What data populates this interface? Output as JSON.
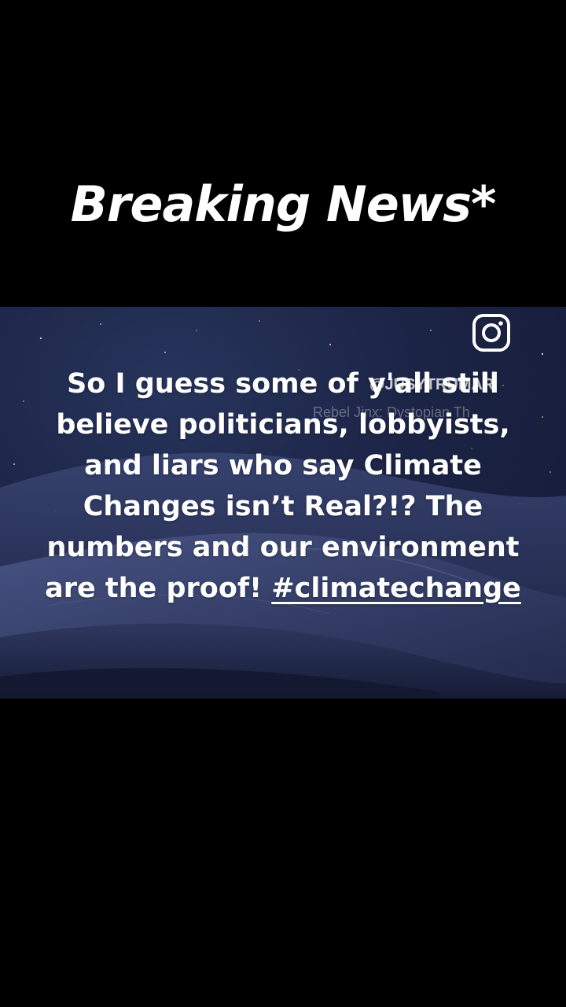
{
  "post": {
    "headline": "Breaking News*",
    "image": {
      "platform_icon": "instagram-icon",
      "watermark_handle": "@JUSYTRUMAR",
      "watermark_sub": "Rebel Jinx: Dystopian Th",
      "body_text": "So I guess some of y'all still believe politicians, lobbyists, and liars who say Climate Changes isn’t Real?!? The numbers and our environment are the proof! ",
      "hashtag": "#climatechange"
    }
  },
  "colors": {
    "background": "#000000",
    "text": "#ffffff",
    "sky": "#1c2446"
  }
}
